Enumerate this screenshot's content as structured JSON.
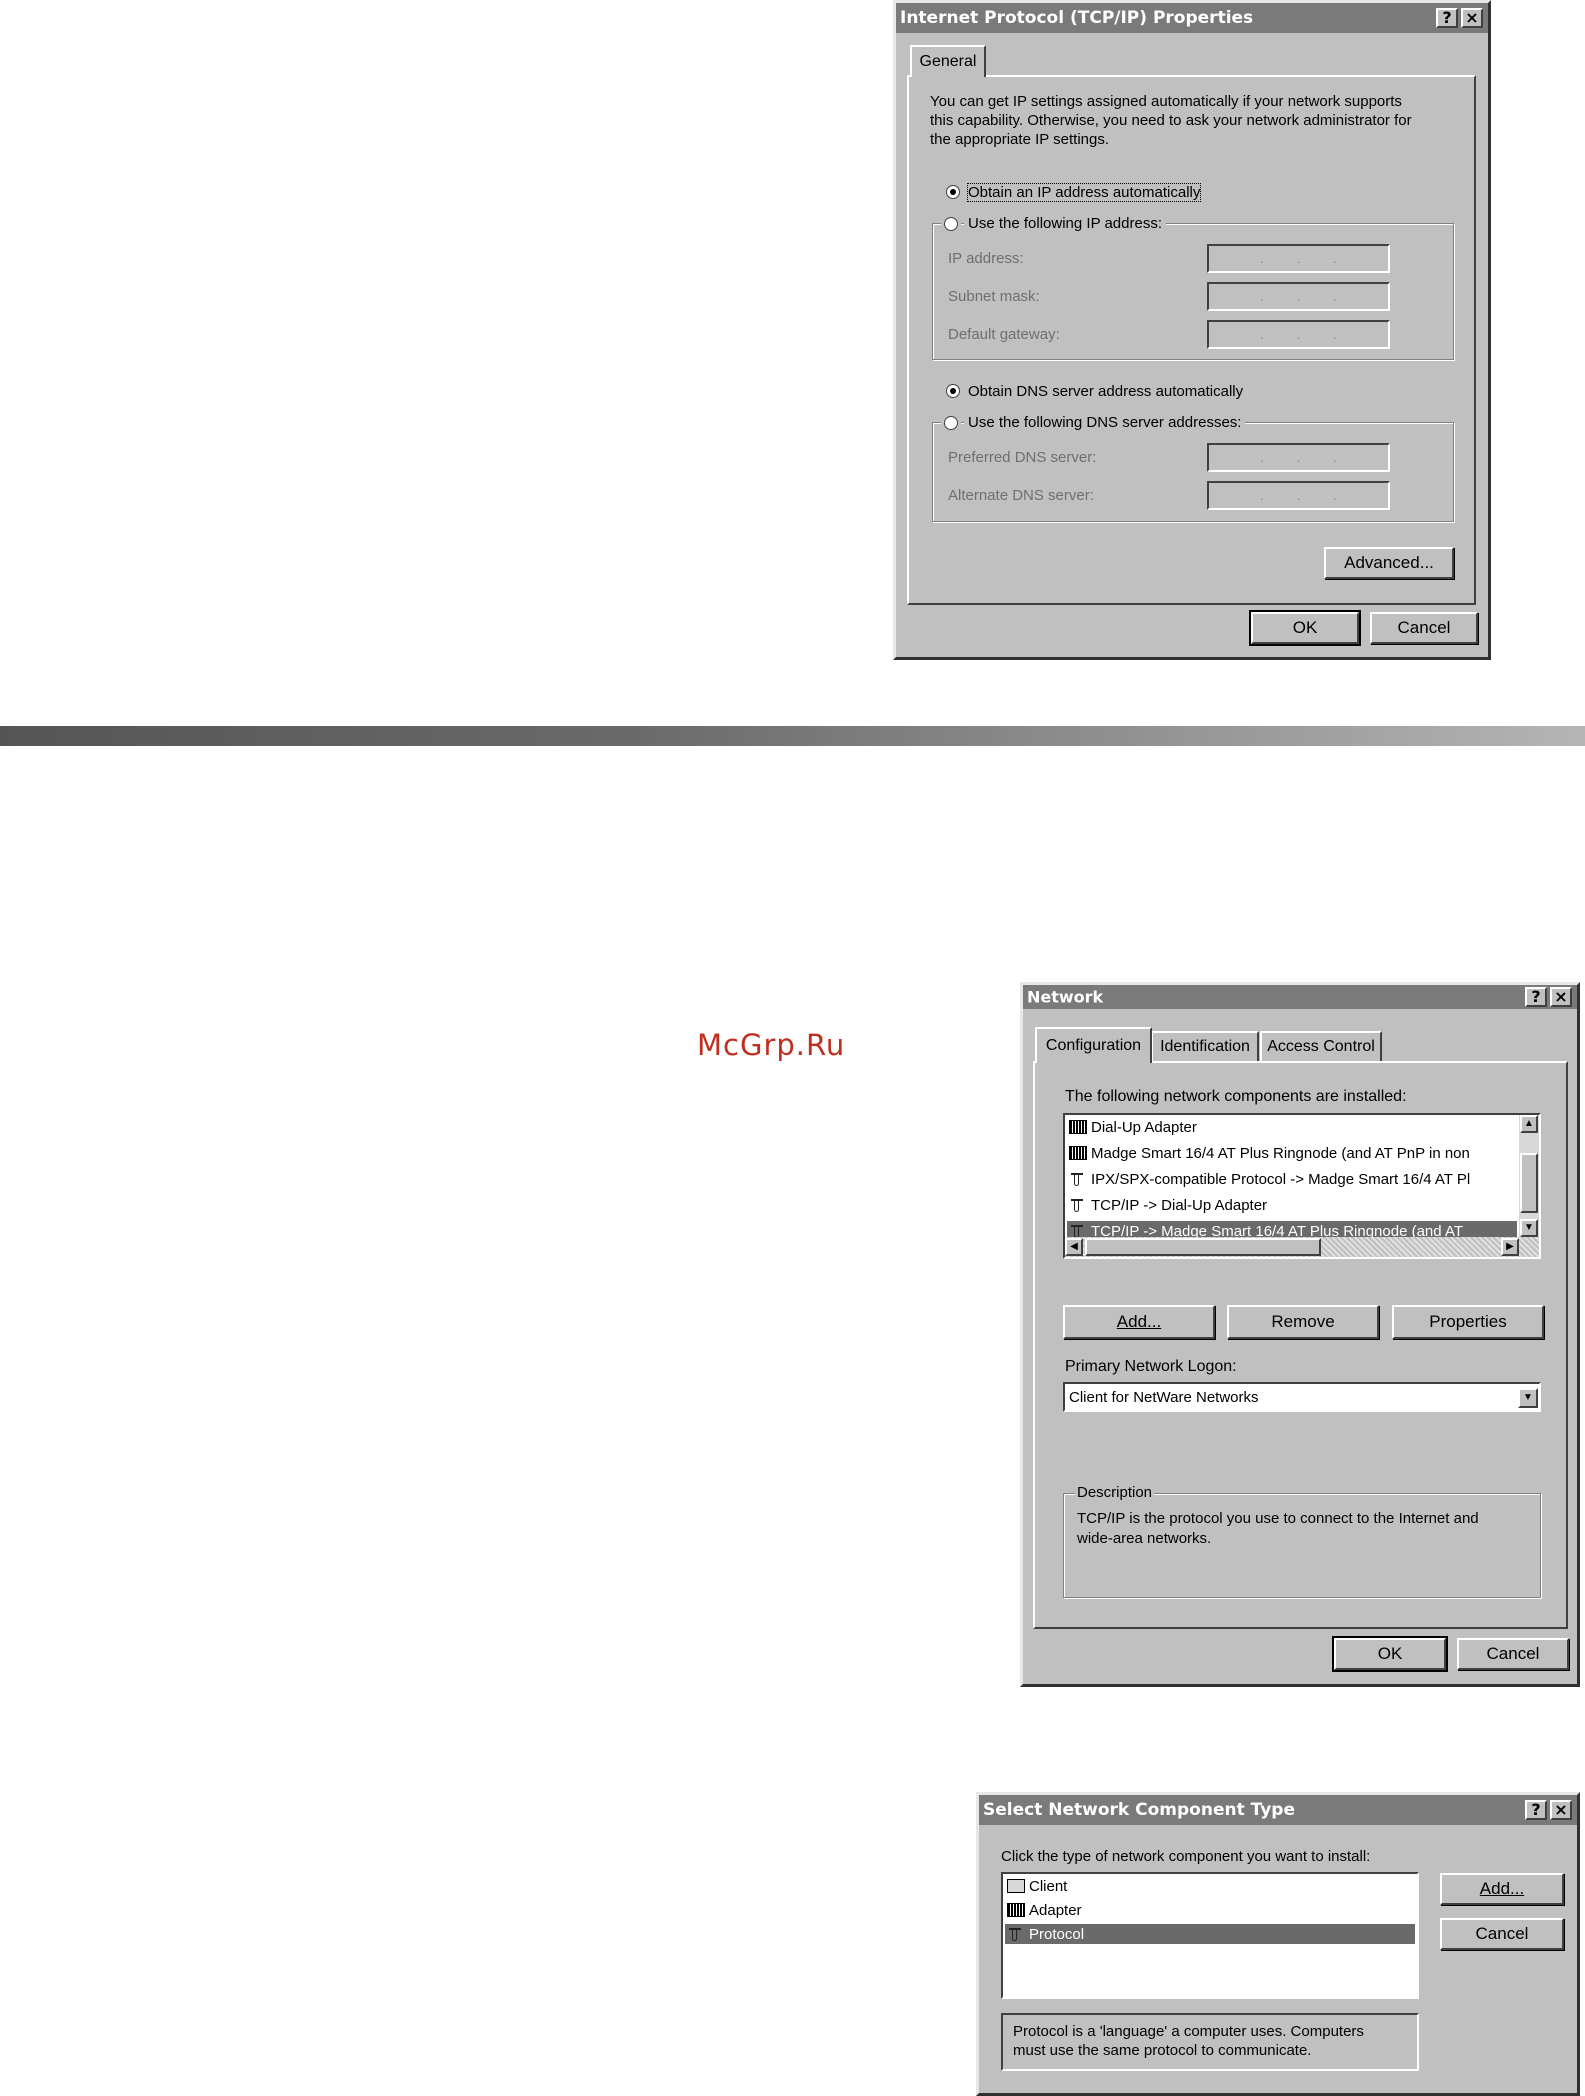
{
  "tcpip_dialog": {
    "title": "Internet Protocol (TCP/IP) Properties",
    "help_btn": "?",
    "close_btn": "×",
    "tab_general": "General",
    "intro_line1": "You can get IP settings assigned automatically if your network supports",
    "intro_line2": "this capability. Otherwise, you need to ask your network administrator for",
    "intro_line3": "the appropriate IP settings.",
    "radio_obtain_ip": "Obtain an IP address automatically",
    "radio_use_ip": "Use the following IP address:",
    "ip_label": "IP address:",
    "subnet_label": "Subnet mask:",
    "gateway_label": "Default gateway:",
    "radio_obtain_dns": "Obtain DNS server address automatically",
    "radio_use_dns": "Use the following DNS server addresses:",
    "preferred_dns_label": "Preferred DNS server:",
    "alternate_dns_label": "Alternate DNS server:",
    "advanced_btn": "Advanced...",
    "ok_btn": "OK",
    "cancel_btn": "Cancel"
  },
  "watermark": "McGrp.Ru",
  "network_dialog": {
    "title": "Network",
    "help_btn": "?",
    "close_btn": "×",
    "tabs": [
      "Configuration",
      "Identification",
      "Access Control"
    ],
    "components_label": "The following network components are installed:",
    "components": [
      {
        "icon": "adapter-icon",
        "label": "Dial-Up Adapter"
      },
      {
        "icon": "adapter-icon",
        "label": "Madge Smart 16/4 AT Plus Ringnode (and AT PnP in non"
      },
      {
        "icon": "protocol-icon",
        "label": "IPX/SPX-compatible Protocol -> Madge Smart 16/4 AT Pl"
      },
      {
        "icon": "protocol-icon",
        "label": "TCP/IP -> Dial-Up Adapter"
      },
      {
        "icon": "protocol-icon",
        "label": "TCP/IP -> Madge Smart 16/4 AT Plus Ringnode (and AT"
      }
    ],
    "add_btn": "Add...",
    "remove_btn": "Remove",
    "properties_btn": "Properties",
    "logon_label": "Primary Network Logon:",
    "logon_value": "Client for NetWare Networks",
    "description_title": "Description",
    "description_line1": "TCP/IP is the protocol you use to connect to the Internet and",
    "description_line2": "wide-area networks.",
    "ok_btn": "OK",
    "cancel_btn": "Cancel"
  },
  "select_dialog": {
    "title": "Select Network Component Type",
    "help_btn": "?",
    "close_btn": "×",
    "prompt": "Click the type of network component you want to install:",
    "items": [
      {
        "icon": "client-icon",
        "label": "Client"
      },
      {
        "icon": "adapter-icon",
        "label": "Adapter"
      },
      {
        "icon": "protocol-icon",
        "label": "Protocol"
      }
    ],
    "add_btn": "Add...",
    "cancel_btn": "Cancel",
    "info_line1": "Protocol is a 'language' a computer uses. Computers",
    "info_line2": "must use the same protocol to communicate."
  }
}
